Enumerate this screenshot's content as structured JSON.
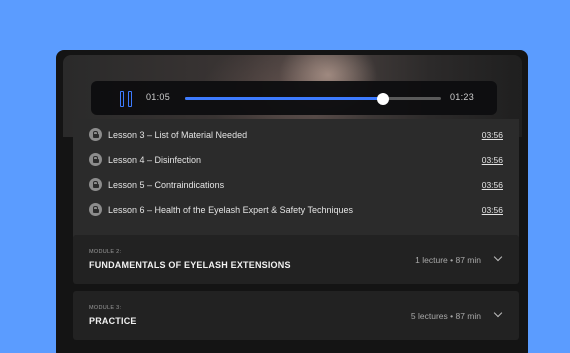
{
  "player": {
    "current_time": "01:05",
    "duration": "01:23",
    "progress_fraction": 0.774,
    "accent_color": "#3d7bff"
  },
  "lessons": [
    {
      "title": "Lesson 3 – List of Material Needed",
      "duration": "03:56",
      "icon": "lock-icon"
    },
    {
      "title": "Lesson 4 – Disinfection",
      "duration": "03:56",
      "icon": "lock-icon"
    },
    {
      "title": "Lesson 5 – Contraindications",
      "duration": "03:56",
      "icon": "lock-icon"
    },
    {
      "title": "Lesson 6 – Health of the Eyelash Expert & Safety Techniques",
      "duration": "03:56",
      "icon": "lock-icon"
    }
  ],
  "modules": [
    {
      "label": "MODULE 2:",
      "title": "FUNDAMENTALS OF EYELASH EXTENSIONS",
      "meta": "1 lecture • 87 min",
      "icon": "chevron-down-icon"
    },
    {
      "label": "MODULE 3:",
      "title": "PRACTICE",
      "meta": "5 lectures • 87 min",
      "icon": "chevron-down-icon"
    }
  ]
}
